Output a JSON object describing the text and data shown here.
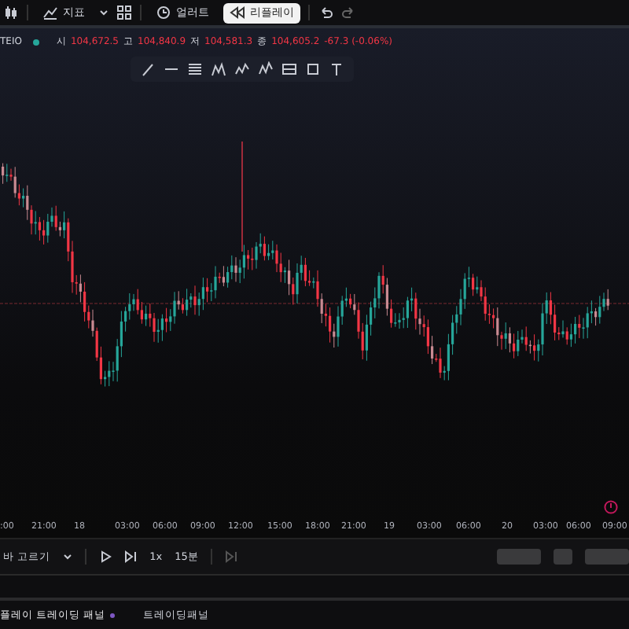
{
  "toolbar": {
    "buttons": [
      {
        "label": "지표",
        "selected": false,
        "kind": "indicator"
      },
      {
        "label": "얼러트",
        "selected": false,
        "kind": "alert"
      },
      {
        "label": "리플레이",
        "selected": true,
        "kind": "replay"
      }
    ]
  },
  "legend": {
    "symbol": "TEIO",
    "values": [
      {
        "label": "시",
        "value": "104,672.5"
      },
      {
        "label": "고",
        "value": "104,840.9"
      },
      {
        "label": "저",
        "value": "104,581.3"
      },
      {
        "label": "종",
        "value": "104,605.2"
      }
    ],
    "change": "-67.3 (-0.06%)"
  },
  "time_axis": {
    "labels": [
      ":00",
      "21:00",
      "18",
      "03:00",
      "06:00",
      "09:00",
      "12:00",
      "15:00",
      "18:00",
      "21:00",
      "19",
      "03:00",
      "06:00",
      "20",
      "03:00",
      "06:00",
      "09:00"
    ]
  },
  "replay": {
    "select_label": "바 고르기",
    "speed": "1x",
    "interval": "15분",
    "buttons": [
      {
        "disabled": true
      },
      {
        "disabled": true
      },
      {
        "disabled": true
      }
    ]
  },
  "bottom_tabs": [
    {
      "label": "플레이 트레이딩 패널",
      "selected": true
    },
    {
      "label": "트레이딩패널",
      "selected": false
    }
  ]
}
